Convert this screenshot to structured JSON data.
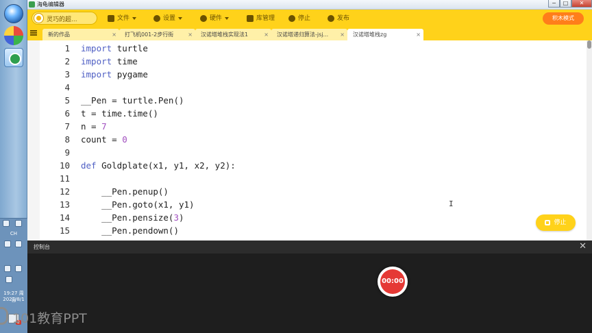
{
  "window": {
    "title": "海龟编辑器",
    "min": "−",
    "max": "□",
    "close": "✕"
  },
  "menubar": {
    "project_name": "灵巧的超...",
    "items": [
      {
        "label": "文件",
        "icon": "file-icon"
      },
      {
        "label": "设置",
        "icon": "gear-icon"
      },
      {
        "label": "硬件",
        "icon": "hardware-icon"
      },
      {
        "label": "库管理",
        "icon": "library-icon"
      },
      {
        "label": "停止",
        "icon": "stop-icon"
      },
      {
        "label": "发布",
        "icon": "send-icon"
      }
    ],
    "mode_button": "积木模式"
  },
  "tabs": [
    {
      "label": "新的作品",
      "close": "×"
    },
    {
      "label": "打飞机001-2步行街",
      "close": "×"
    },
    {
      "label": "汉诺塔堆栈实现法1",
      "close": "×"
    },
    {
      "label": "汉诺塔递归算法-jsj...",
      "close": "×"
    },
    {
      "label": "汉诺塔堆栈zg",
      "close": "×"
    }
  ],
  "editor": {
    "lines": [
      {
        "num": "1",
        "code": [
          [
            "kw",
            "import"
          ],
          [
            "",
            "turtle"
          ]
        ]
      },
      {
        "num": "2",
        "code": [
          [
            "kw",
            "import"
          ],
          [
            "",
            "time"
          ]
        ]
      },
      {
        "num": "3",
        "code": [
          [
            "kw",
            "import"
          ],
          [
            "",
            "pygame"
          ]
        ]
      },
      {
        "num": "4",
        "code": []
      },
      {
        "num": "5",
        "code": [
          [
            "",
            "__Pen = turtle.Pen()"
          ]
        ]
      },
      {
        "num": "6",
        "code": [
          [
            "",
            "t = time.time()"
          ]
        ]
      },
      {
        "num": "7",
        "code": [
          [
            "",
            "n = "
          ],
          [
            "nm",
            "7"
          ]
        ]
      },
      {
        "num": "8",
        "code": [
          [
            "",
            "count = "
          ],
          [
            "nm",
            "0"
          ]
        ]
      },
      {
        "num": "9",
        "code": []
      },
      {
        "num": "10",
        "code": [
          [
            "kw",
            "def"
          ],
          [
            "",
            "Goldplate(x1, y1, x2, y2):"
          ]
        ]
      },
      {
        "num": "11",
        "code": []
      },
      {
        "num": "12",
        "code": [
          [
            "",
            "    __Pen.penup()"
          ]
        ]
      },
      {
        "num": "13",
        "code": [
          [
            "",
            "    __Pen.goto(x1, y1)"
          ]
        ]
      },
      {
        "num": "14",
        "code": [
          [
            "",
            "    __Pen.pensize("
          ],
          [
            "nm",
            "3"
          ],
          [
            "",
            ")"
          ]
        ]
      },
      {
        "num": "15",
        "code": [
          [
            "",
            "    __Pen.pendown()"
          ]
        ]
      }
    ],
    "cursor_glyph": "I",
    "stop_button": "停止"
  },
  "console": {
    "title": "控制台",
    "close": "✕"
  },
  "recorder": {
    "time": "00:00"
  },
  "taskbar": {
    "lang": "CH",
    "clock_time": "19:27 周日",
    "clock_date": "2021/8/1",
    "badge": "2"
  },
  "watermark": {
    "text": "101教育PPT"
  }
}
